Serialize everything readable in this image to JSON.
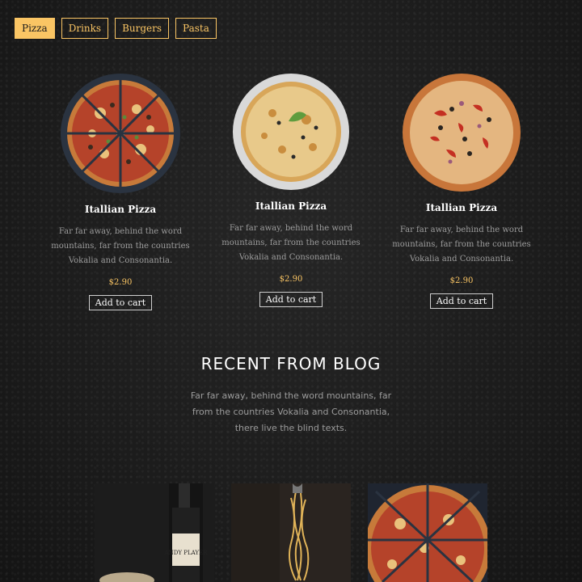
{
  "tabs": [
    {
      "label": "Pizza",
      "active": true
    },
    {
      "label": "Drinks",
      "active": false
    },
    {
      "label": "Burgers",
      "active": false
    },
    {
      "label": "Pasta",
      "active": false
    }
  ],
  "products": [
    {
      "title": "Itallian Pizza",
      "description": "Far far away, behind the word mountains, far from the countries Vokalia and Consonantia.",
      "price": "$2.90",
      "button": "Add to cart"
    },
    {
      "title": "Itallian Pizza",
      "description": "Far far away, behind the word mountains, far from the countries Vokalia and Consonantia.",
      "price": "$2.90",
      "button": "Add to cart"
    },
    {
      "title": "Itallian Pizza",
      "description": "Far far away, behind the word mountains, far from the countries Vokalia and Consonantia.",
      "price": "$2.90",
      "button": "Add to cart"
    }
  ],
  "blog": {
    "heading": "RECENT FROM BLOG",
    "subtitle": "Far far away, behind the word mountains, far from the countries Vokalia and Consonantia, there live the blind texts.",
    "bottle_label": "ANDY PLAYER"
  },
  "colors": {
    "accent": "#fac564",
    "background": "#1d1d1d",
    "muted_text": "#9c9c9c"
  }
}
